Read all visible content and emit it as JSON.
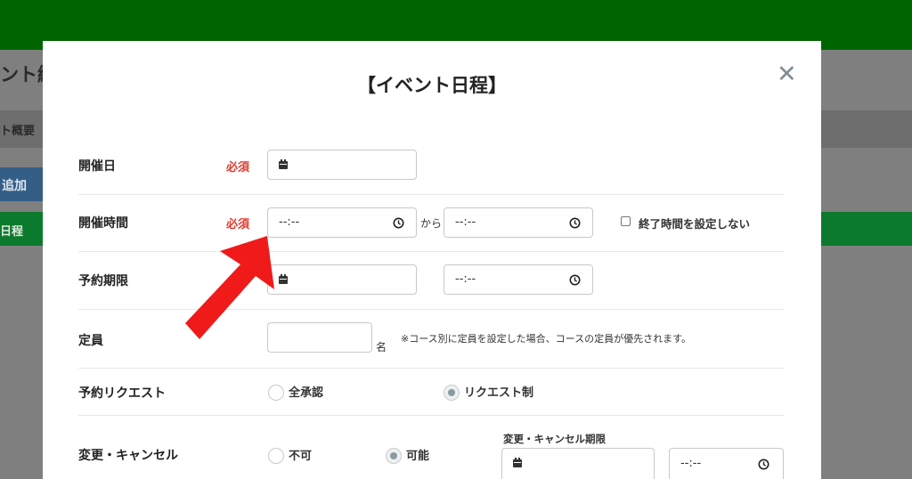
{
  "background": {
    "title_fragment": "ント編",
    "tab_fragment": "ト概要",
    "add_fragment": "追加",
    "greenbar_fragment": "日程"
  },
  "modal": {
    "title": "【イベント日程】",
    "close": "✕"
  },
  "rows": {
    "date": {
      "label": "開催日",
      "required": "必須"
    },
    "time": {
      "label": "開催時間",
      "required": "必須",
      "start_value": "--:--",
      "connector": "から",
      "end_value": "--:--",
      "no_end_label": "終了時間を設定しない"
    },
    "deadline": {
      "label": "予約期限",
      "time_value": "--:--"
    },
    "capacity": {
      "label": "定員",
      "unit": "名",
      "note": "※コース別に定員を設定した場合、コースの定員が優先されます。"
    },
    "request": {
      "label": "予約リクエスト",
      "option_auto": "全承認",
      "option_request": "リクエスト制"
    },
    "change": {
      "label": "変更・キャンセル",
      "option_no": "不可",
      "option_yes": "可能",
      "deadline_label": "変更・キャンセル期限",
      "time_value": "--:--"
    }
  },
  "colors": {
    "topbar": "#006400",
    "required": "#e23b2f",
    "arrow": "#f01a1a",
    "greenbar": "#0b7a2c"
  },
  "icons": {
    "calendar": "calendar-icon",
    "clock": "clock-icon",
    "arrow": "red-arrow-annotation"
  }
}
